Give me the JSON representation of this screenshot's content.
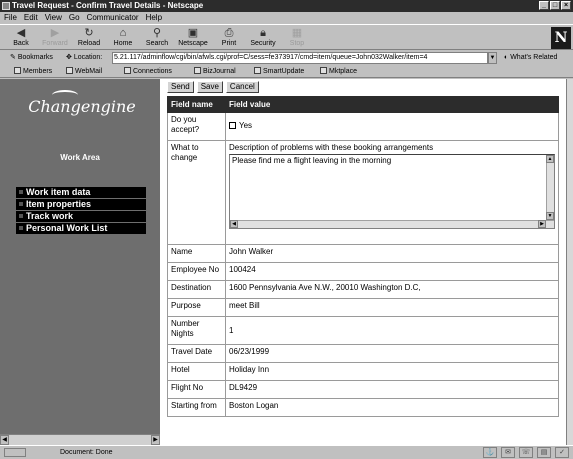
{
  "window": {
    "title": "Travel Request - Confirm Travel Details - Netscape"
  },
  "menu": {
    "items": [
      "File",
      "Edit",
      "View",
      "Go",
      "Communicator",
      "Help"
    ]
  },
  "nav_toolbar": {
    "buttons": [
      {
        "label": "Back",
        "icon": "back-arrow-icon",
        "enabled": true
      },
      {
        "label": "Forward",
        "icon": "forward-arrow-icon",
        "enabled": false
      },
      {
        "label": "Reload",
        "icon": "reload-icon",
        "enabled": true
      },
      {
        "label": "Home",
        "icon": "home-icon",
        "enabled": true
      },
      {
        "label": "Search",
        "icon": "search-icon",
        "enabled": true
      },
      {
        "label": "Netscape",
        "icon": "netscape-icon",
        "enabled": true
      },
      {
        "label": "Print",
        "icon": "print-icon",
        "enabled": true
      },
      {
        "label": "Security",
        "icon": "lock-icon",
        "enabled": true
      },
      {
        "label": "Stop",
        "icon": "stop-icon",
        "enabled": false
      }
    ],
    "brand_letter": "N"
  },
  "location_bar": {
    "bookmarks_label": "Bookmarks",
    "location_label": "Location:",
    "url": "5.21.117/adminflow/cgi/bin/afwls.cgi/prof=C/sess=fe373917/cmd=item/queue=John032Walker/item=4",
    "whats_related": "What's Related"
  },
  "personal_toolbar": {
    "items": [
      "Members",
      "WebMail",
      "Connections",
      "BizJournal",
      "SmartUpdate",
      "Mktplace"
    ]
  },
  "left_panel": {
    "logo_text": "Changengine",
    "section_title": "Work Area",
    "nav_items": [
      "Work item data",
      "Item properties",
      "Track work",
      "Personal Work List"
    ]
  },
  "actions": {
    "send": "Send",
    "save": "Save",
    "cancel": "Cancel"
  },
  "form": {
    "header_name": "Field name",
    "header_value": "Field value",
    "accept": {
      "label": "Do you accept?",
      "option": "Yes"
    },
    "change": {
      "label": "What to change",
      "description": "Description of problems with these booking arrangements",
      "text": "Please find me a flight leaving in the morning"
    },
    "rows": [
      {
        "label": "Name",
        "value": "John Walker"
      },
      {
        "label": "Employee No",
        "value": "100424"
      },
      {
        "label": "Destination",
        "value": "1600 Pennsylvania Ave N.W., 20010 Washington D.C,"
      },
      {
        "label": "Purpose",
        "value": "meet Bill"
      },
      {
        "label": "Number Nights",
        "value": "1"
      },
      {
        "label": "Travel Date",
        "value": "06/23/1999"
      },
      {
        "label": "Hotel",
        "value": "Holiday Inn"
      },
      {
        "label": "Flight No",
        "value": "DL9429"
      },
      {
        "label": "Starting from",
        "value": "Boston Logan"
      }
    ]
  },
  "status": {
    "text": "Document: Done"
  }
}
